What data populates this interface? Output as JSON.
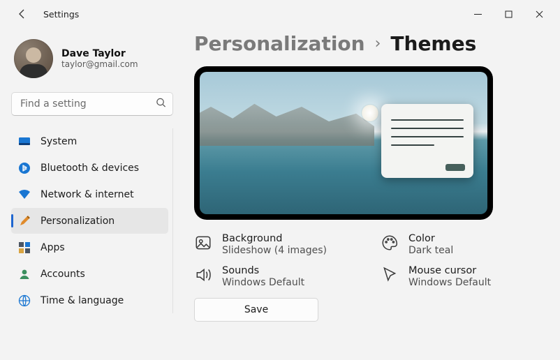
{
  "window": {
    "title": "Settings"
  },
  "account": {
    "name": "Dave Taylor",
    "email": "taylor@gmail.com"
  },
  "search": {
    "placeholder": "Find a setting"
  },
  "nav": {
    "items": [
      {
        "id": "system",
        "label": "System"
      },
      {
        "id": "bluetooth",
        "label": "Bluetooth & devices"
      },
      {
        "id": "network",
        "label": "Network & internet"
      },
      {
        "id": "personalization",
        "label": "Personalization"
      },
      {
        "id": "apps",
        "label": "Apps"
      },
      {
        "id": "accounts",
        "label": "Accounts"
      },
      {
        "id": "time",
        "label": "Time & language"
      }
    ],
    "active": "personalization"
  },
  "breadcrumb": {
    "parent": "Personalization",
    "current": "Themes"
  },
  "theme": {
    "background": {
      "label": "Background",
      "value": "Slideshow (4 images)"
    },
    "color": {
      "label": "Color",
      "value": "Dark teal"
    },
    "sounds": {
      "label": "Sounds",
      "value": "Windows Default"
    },
    "cursor": {
      "label": "Mouse cursor",
      "value": "Windows Default"
    }
  },
  "actions": {
    "save": "Save"
  }
}
